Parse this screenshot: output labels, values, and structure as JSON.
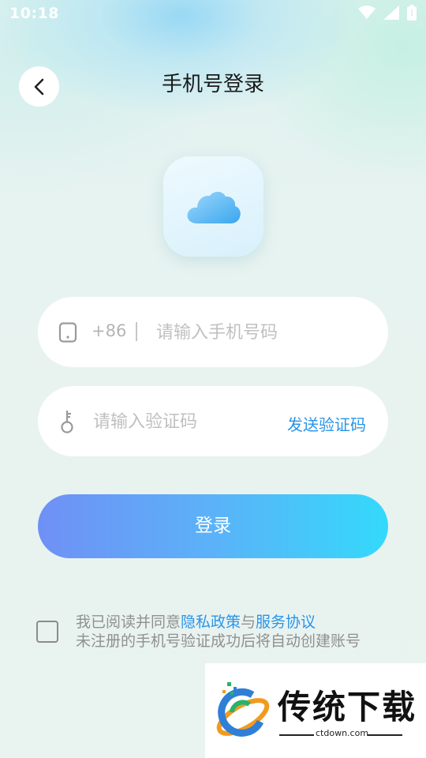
{
  "statusbar": {
    "time": "10:18"
  },
  "header": {
    "title": "手机号登录"
  },
  "phone": {
    "prefix": "+86",
    "placeholder": "请输入手机号码"
  },
  "code": {
    "placeholder": "请输入验证码",
    "send_label": "发送验证码"
  },
  "login": {
    "label": "登录"
  },
  "agreement": {
    "part1": "我已阅读并同意",
    "privacy_link": "隐私政策",
    "and": "与",
    "service_link": "服务协议",
    "line2": "未注册的手机号验证成功后将自动创建账号"
  },
  "watermark": {
    "brand": "传统下载",
    "url": "ctdown.com"
  },
  "colors": {
    "accent": "#2a94e8",
    "button_start": "#6f90f5",
    "button_end": "#34d9fb"
  },
  "icons": [
    "back-icon",
    "cloud-icon",
    "phone-icon",
    "key-icon",
    "wifi-icon",
    "signal-icon",
    "battery-icon"
  ]
}
